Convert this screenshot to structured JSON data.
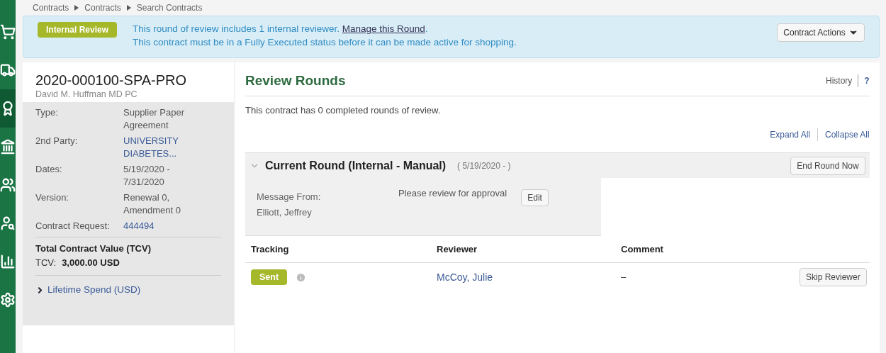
{
  "sidebar": {
    "items": [
      {
        "kind": "cart",
        "selected": false
      },
      {
        "kind": "truck",
        "selected": false
      },
      {
        "kind": "award",
        "selected": true
      },
      {
        "kind": "bank",
        "selected": false
      },
      {
        "kind": "users",
        "selected": false
      },
      {
        "kind": "search",
        "selected": false
      },
      {
        "kind": "chart",
        "selected": false
      },
      {
        "kind": "settings",
        "selected": false
      }
    ]
  },
  "breadcrumb": [
    "Contracts",
    "Contracts",
    "Search Contracts"
  ],
  "banner": {
    "badge": "Internal Review",
    "line1": "This round of review includes 1 internal reviewer.",
    "link": "Manage this Round",
    "link_end": ".",
    "line2": "This contract must be in a Fully Executed status before it can be made active for shopping.",
    "actions": "Contract Actions"
  },
  "contract": {
    "number": "2020-000100-SPA-PRO",
    "supplier": "David M. Huffman MD PC",
    "fields": [
      {
        "label": "Type:",
        "value": "Supplier Paper Agreement",
        "link": false
      },
      {
        "label": "2nd Party:",
        "value": "UNIVERSITY DIABETES...",
        "link": true
      },
      {
        "label": "Dates:",
        "value": "5/19/2020 - 7/31/2020",
        "link": false
      },
      {
        "label": "Version:",
        "value": "Renewal 0, Amendment 0",
        "link": false
      },
      {
        "label": "Contract Request:",
        "value": "444494",
        "link": true
      }
    ],
    "tcv_title": "Total Contract Value (TCV)",
    "tcv_label": "TCV:",
    "tcv_value": "3,000.00 USD",
    "lifetime": "Lifetime Spend (USD)"
  },
  "review": {
    "title": "Review Rounds",
    "history": "History",
    "help": "?",
    "summary": "This contract has 0 completed rounds of review.",
    "expand": "Expand All",
    "collapse": "Collapse All",
    "round": {
      "title": "Current Round (Internal - Manual)",
      "dates": "( 5/19/2020 - )",
      "end": "End Round Now",
      "expanded": true,
      "message_label": "Message From:",
      "message_from": "Elliott, Jeffrey",
      "message": "Please review for approval",
      "edit": "Edit",
      "columns": [
        "Tracking",
        "Reviewer",
        "Comment"
      ],
      "rows": [
        {
          "status": "Sent",
          "reviewer": "McCoy, Julie",
          "comment": "–",
          "action": "Skip Reviewer"
        }
      ]
    }
  }
}
